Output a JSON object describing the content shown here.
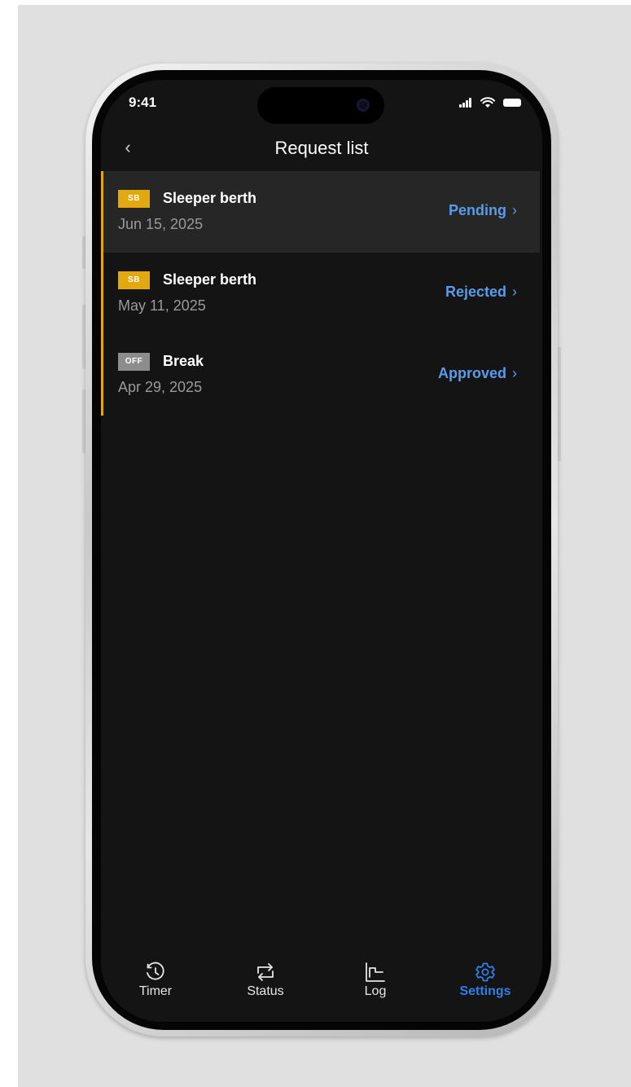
{
  "status_bar": {
    "time": "9:41"
  },
  "header": {
    "title": "Request list",
    "back_icon": "chevron-left-icon"
  },
  "requests": [
    {
      "badge": "SB",
      "title": "Sleeper berth",
      "date": "Jun 15, 2025",
      "status": "Pending",
      "selected": true
    },
    {
      "badge": "SB",
      "title": "Sleeper berth",
      "date": "May 11, 2025",
      "status": "Rejected",
      "selected": false
    },
    {
      "badge": "OFF",
      "title": "Break",
      "date": "Apr 29, 2025",
      "status": "Approved",
      "selected": false
    }
  ],
  "tab_bar": {
    "tabs": [
      {
        "label": "Timer",
        "icon": "timer-history-icon"
      },
      {
        "label": "Status",
        "icon": "status-swap-icon"
      },
      {
        "label": "Log",
        "icon": "log-chart-icon"
      },
      {
        "label": "Settings",
        "icon": "gear-icon"
      }
    ],
    "active": "Settings"
  },
  "colors": {
    "screen_bg": "#141414",
    "selected_row_bg": "#262626",
    "accent_yellow": "#e2a80d",
    "off_badge_gray": "#8c8c8c",
    "status_link_blue": "#5b9be8",
    "active_tab_blue": "#2f7fe6"
  }
}
